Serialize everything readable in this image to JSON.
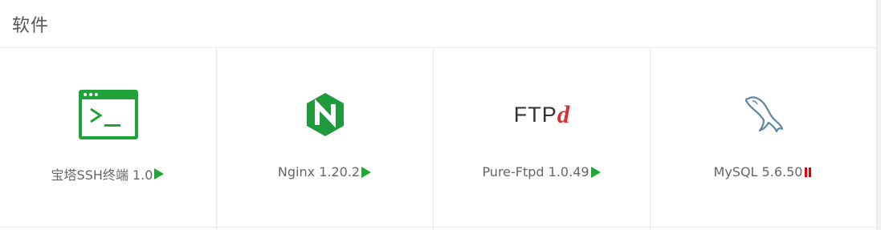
{
  "section": {
    "title": "软件"
  },
  "software": [
    {
      "label": "宝塔SSH终端 1.0",
      "icon": "terminal-icon",
      "status": "running",
      "status_icon": "play-triangle-icon"
    },
    {
      "label": "Nginx 1.20.2",
      "icon": "nginx-icon",
      "status": "running",
      "status_icon": "play-triangle-icon"
    },
    {
      "label": "Pure-Ftpd 1.0.49",
      "icon": "ftpd-icon",
      "icon_text": "FTP",
      "icon_suffix": "d",
      "status": "running",
      "status_icon": "play-triangle-icon"
    },
    {
      "label": "MySQL 5.6.50",
      "icon": "mysql-dolphin-icon",
      "status": "stopped",
      "status_icon": "pause-icon"
    }
  ],
  "colors": {
    "running": "#20a53a",
    "stopped": "#e60000",
    "nginx": "#1f9a3d",
    "terminal": "#22a33a",
    "ftpd_accent": "#d63031",
    "mysql": "#5d87a1"
  }
}
